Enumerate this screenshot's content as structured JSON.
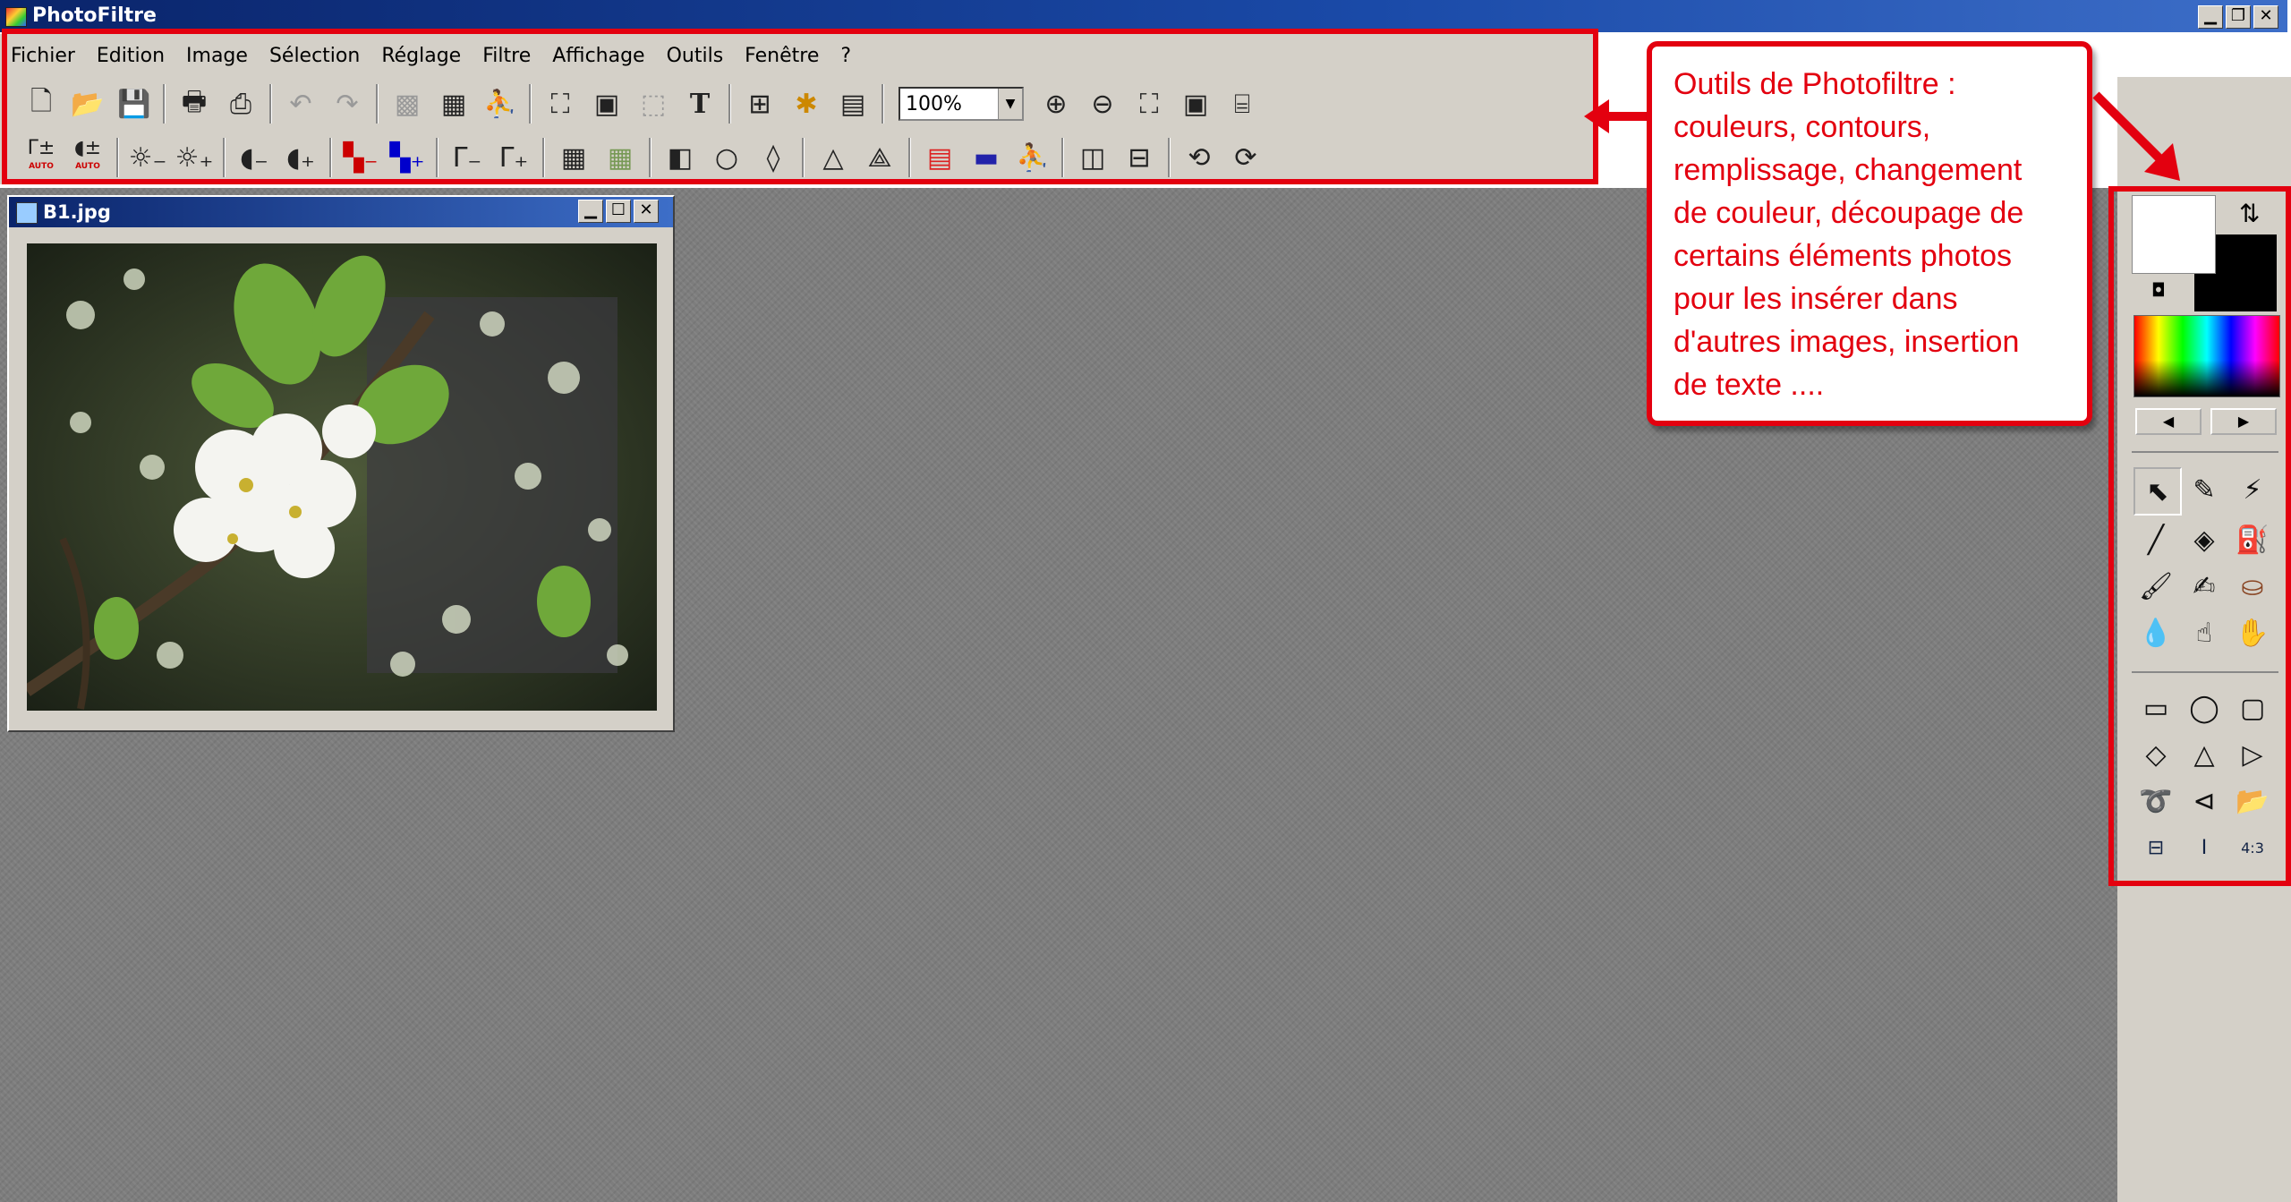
{
  "app": {
    "title": "PhotoFiltre"
  },
  "menu": [
    "Fichier",
    "Edition",
    "Image",
    "Sélection",
    "Réglage",
    "Filtre",
    "Affichage",
    "Outils",
    "Fenêtre",
    "?"
  ],
  "toolbar": {
    "zoom_value": "100%",
    "auto_label": "AUTO"
  },
  "document": {
    "title": "B1.jpg"
  },
  "annotation": {
    "lines": [
      "Outils de Photofiltre :",
      "couleurs, contours,",
      "remplissage, changement",
      "de couleur, découpage de",
      "certains éléments photos",
      "pour les insérer dans",
      "d'autres images, insertion",
      "de texte ...."
    ]
  },
  "colors": {
    "accent": "#e3000f",
    "titlebar": "#0a246a",
    "workspace": "#7d7d7d",
    "chrome": "#d4d0c8"
  }
}
